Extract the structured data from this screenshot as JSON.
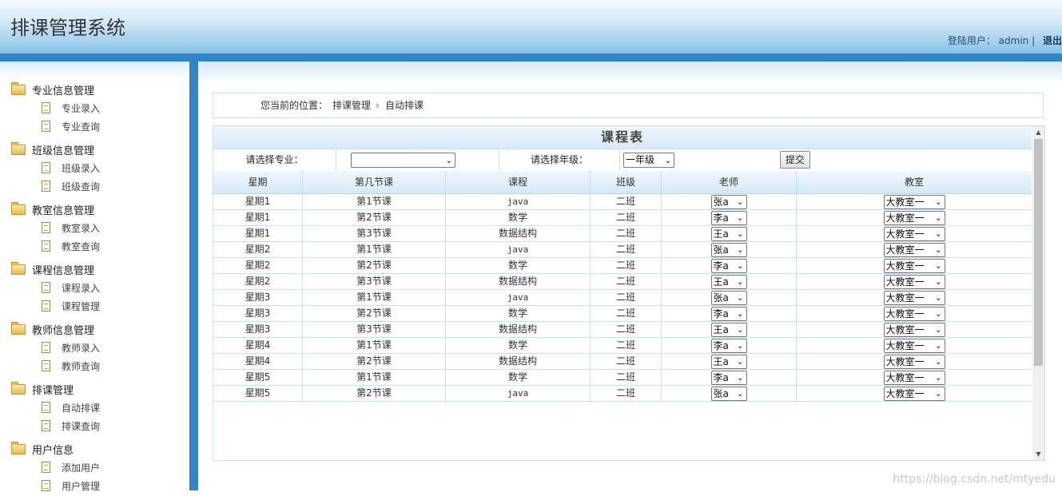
{
  "header": {
    "title": "排课管理系统",
    "user_label": "登陆用户：",
    "username": "admin",
    "divider": "|",
    "logout": "退出"
  },
  "sidebar": {
    "groups": [
      {
        "title": "专业信息管理",
        "items": [
          "专业录入",
          "专业查询"
        ]
      },
      {
        "title": "班级信息管理",
        "items": [
          "班级录入",
          "班级查询"
        ]
      },
      {
        "title": "教室信息管理",
        "items": [
          "教室录入",
          "教室查询"
        ]
      },
      {
        "title": "课程信息管理",
        "items": [
          "课程录入",
          "课程管理"
        ]
      },
      {
        "title": "教师信息管理",
        "items": [
          "教师录入",
          "教师查询"
        ]
      },
      {
        "title": "排课管理",
        "items": [
          "自动排课",
          "排课查询"
        ]
      },
      {
        "title": "用户信息",
        "items": [
          "添加用户",
          "用户管理"
        ]
      }
    ]
  },
  "breadcrumb": {
    "label": "您当前的位置：",
    "parent": "排课管理",
    "separator": "›",
    "current": "自动排课"
  },
  "schedule": {
    "title": "课程表",
    "filter": {
      "major_label": "请选择专业：",
      "major_value": "",
      "grade_label": "请选择年级：",
      "grade_value": "一年级",
      "submit": "提交"
    },
    "columns": [
      "星期",
      "第几节课",
      "课程",
      "班级",
      "老师",
      "教室"
    ],
    "rows": [
      [
        "星期1",
        "第1节课",
        "java",
        "二班",
        "张a",
        "大教室一"
      ],
      [
        "星期1",
        "第2节课",
        "数学",
        "二班",
        "李a",
        "大教室一"
      ],
      [
        "星期1",
        "第3节课",
        "数据结构",
        "二班",
        "王a",
        "大教室一"
      ],
      [
        "星期2",
        "第1节课",
        "java",
        "二班",
        "张a",
        "大教室一"
      ],
      [
        "星期2",
        "第2节课",
        "数学",
        "二班",
        "李a",
        "大教室一"
      ],
      [
        "星期2",
        "第3节课",
        "数据结构",
        "二班",
        "王a",
        "大教室一"
      ],
      [
        "星期3",
        "第1节课",
        "java",
        "二班",
        "张a",
        "大教室一"
      ],
      [
        "星期3",
        "第2节课",
        "数学",
        "二班",
        "李a",
        "大教室一"
      ],
      [
        "星期3",
        "第3节课",
        "数据结构",
        "二班",
        "王a",
        "大教室一"
      ],
      [
        "星期4",
        "第1节课",
        "数学",
        "二班",
        "李a",
        "大教室一"
      ],
      [
        "星期4",
        "第2节课",
        "数据结构",
        "二班",
        "王a",
        "大教室一"
      ],
      [
        "星期5",
        "第1节课",
        "数学",
        "二班",
        "李a",
        "大教室一"
      ],
      [
        "星期5",
        "第2节课",
        "java",
        "二班",
        "张a",
        "大教室一"
      ]
    ]
  },
  "watermark": "https://blog.csdn.net/mtyedu"
}
